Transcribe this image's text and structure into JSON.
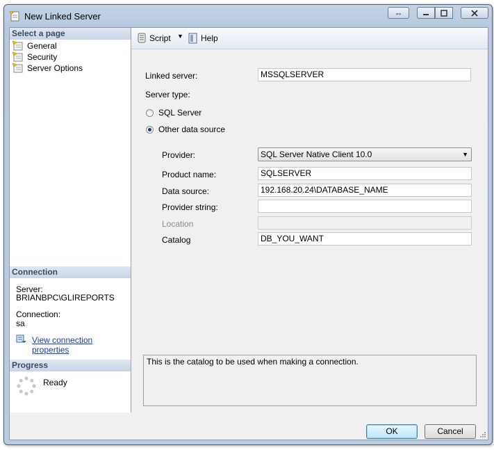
{
  "window": {
    "title": "New Linked Server",
    "controls": {
      "restore_icon": "resize-arrows-icon",
      "minimize": "minimize-icon",
      "maximize": "maximize-icon",
      "close": "close-icon"
    }
  },
  "left": {
    "select_page_header": "Select a page",
    "pages": [
      {
        "label": "General",
        "icon": "page-icon"
      },
      {
        "label": "Security",
        "icon": "page-icon"
      },
      {
        "label": "Server Options",
        "icon": "page-icon"
      }
    ],
    "connection_header": "Connection",
    "server_label": "Server:",
    "server_value": "BRIANBPC\\GLIREPORTS",
    "connection_label": "Connection:",
    "connection_value": "sa",
    "view_properties_link": "View connection properties",
    "progress_header": "Progress",
    "progress_status": "Ready"
  },
  "toolbar": {
    "script_label": "Script",
    "help_label": "Help"
  },
  "form": {
    "linked_server_label": "Linked server:",
    "linked_server_value": "MSSQLSERVER",
    "server_type_label": "Server type:",
    "radio_sql_server": "SQL Server",
    "radio_other": "Other data source",
    "selected_server_type": "Other data source",
    "provider_label": "Provider:",
    "provider_value": "SQL Server Native Client 10.0",
    "product_name_label": "Product name:",
    "product_name_value": "SQLSERVER",
    "data_source_label": "Data source:",
    "data_source_value": "192.168.20.24\\DATABASE_NAME",
    "provider_string_label": "Provider string:",
    "provider_string_value": "",
    "location_label": "Location",
    "location_value": "",
    "catalog_label": "Catalog",
    "catalog_value": "DB_YOU_WANT",
    "description": "This is the catalog to be used when making a connection."
  },
  "buttons": {
    "ok": "OK",
    "cancel": "Cancel"
  },
  "colors": {
    "title_bar": "#b8c9df",
    "section_header_text": "#3b4b61",
    "link": "#1a3fa8",
    "default_button": "#bee6fd"
  }
}
